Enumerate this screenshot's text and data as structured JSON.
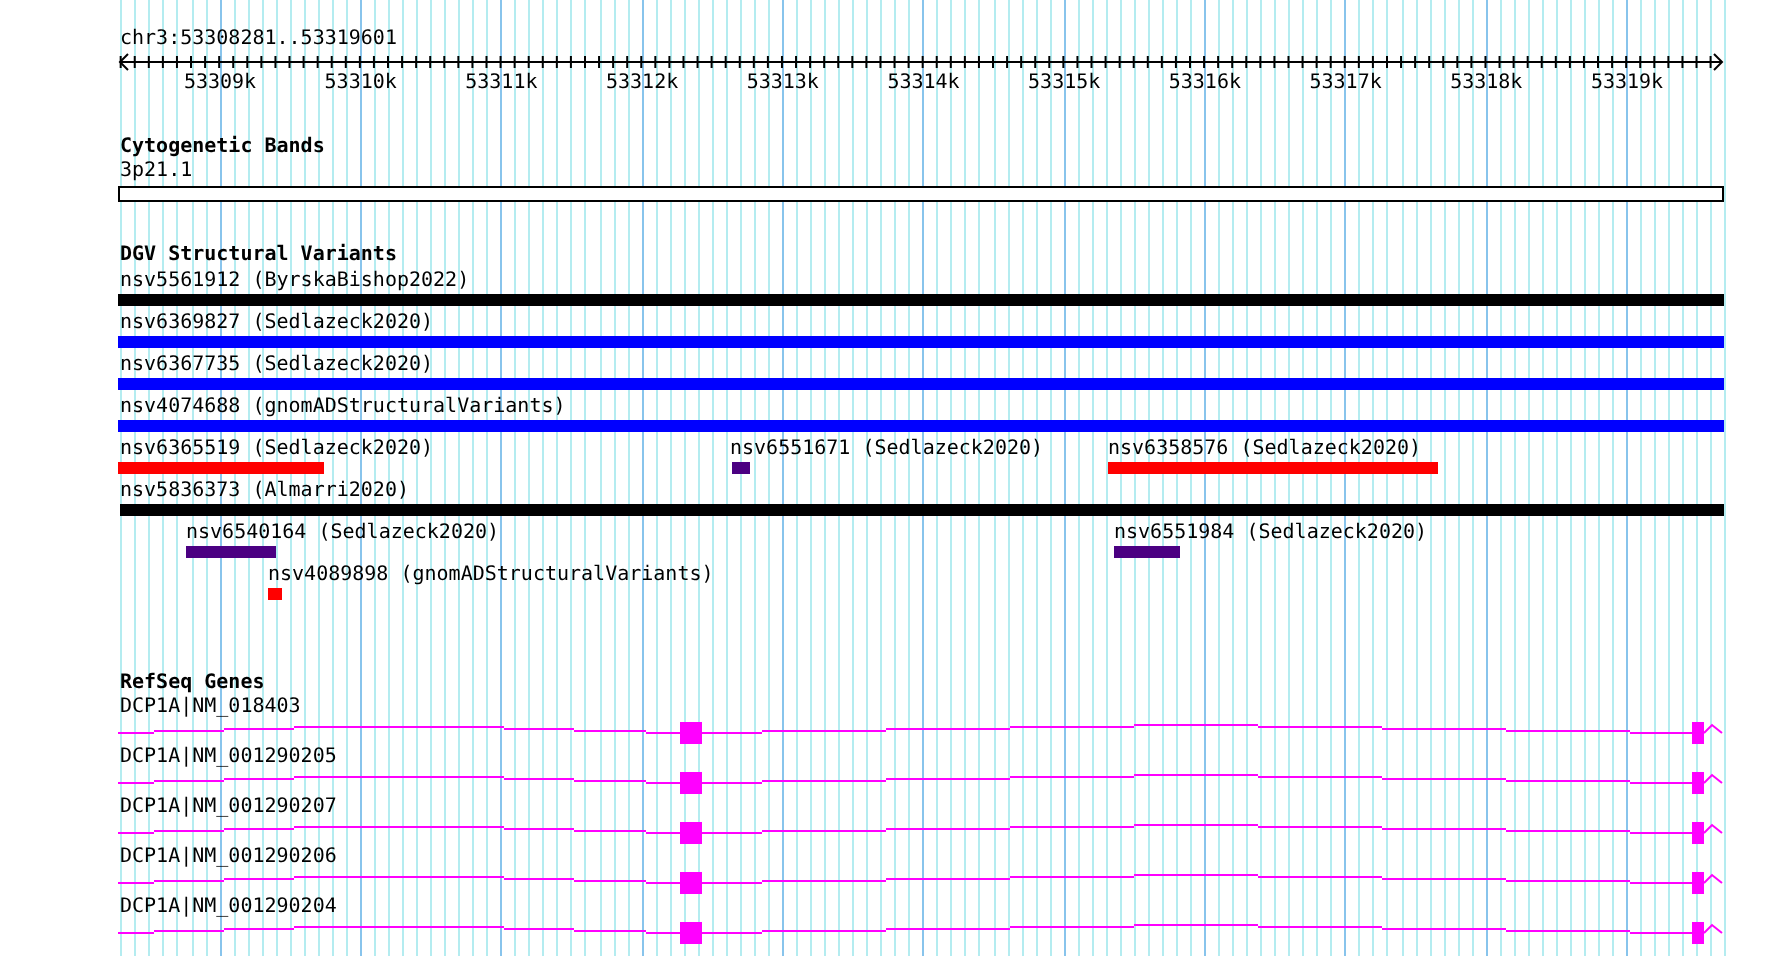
{
  "ruler": {
    "location": "chr3:53308281..53319601",
    "ticks": [
      "53309k",
      "53310k",
      "53311k",
      "53312k",
      "53313k",
      "53314k",
      "53315k",
      "53316k",
      "53317k",
      "53318k",
      "53319k"
    ]
  },
  "tracks": [
    {
      "kind": "cytoband",
      "title": "Cytogenetic Bands",
      "features": [
        {
          "label": "3p21.1"
        }
      ]
    },
    {
      "kind": "variants",
      "title": "DGV Structural Variants",
      "features": [
        {
          "label": "nsv5561912 (ByrskaBishop2022)",
          "color": "#000000"
        },
        {
          "label": "nsv6369827 (Sedlazeck2020)",
          "color": "#0000ff"
        },
        {
          "label": "nsv6367735 (Sedlazeck2020)",
          "color": "#0000ff"
        },
        {
          "label": "nsv4074688 (gnomADStructuralVariants)",
          "color": "#0000ff"
        },
        {
          "label": "nsv6365519 (Sedlazeck2020)",
          "color": "#ff0000"
        },
        {
          "label": "nsv6551671 (Sedlazeck2020)",
          "color": "#4b0082"
        },
        {
          "label": "nsv6358576 (Sedlazeck2020)",
          "color": "#ff0000"
        },
        {
          "label": "nsv5836373 (Almarri2020)",
          "color": "#000000"
        },
        {
          "label": "nsv6540164 (Sedlazeck2020)",
          "color": "#4b0082"
        },
        {
          "label": "nsv6551984 (Sedlazeck2020)",
          "color": "#4b0082"
        },
        {
          "label": "nsv4089898 (gnomADStructuralVariants)",
          "color": "#ff0000"
        }
      ]
    },
    {
      "kind": "genes",
      "title": "RefSeq Genes",
      "features": [
        {
          "label": "DCP1A|NM_018403"
        },
        {
          "label": "DCP1A|NM_001290205"
        },
        {
          "label": "DCP1A|NM_001290207"
        },
        {
          "label": "DCP1A|NM_001290206"
        },
        {
          "label": "DCP1A|NM_001290204"
        }
      ]
    }
  ]
}
